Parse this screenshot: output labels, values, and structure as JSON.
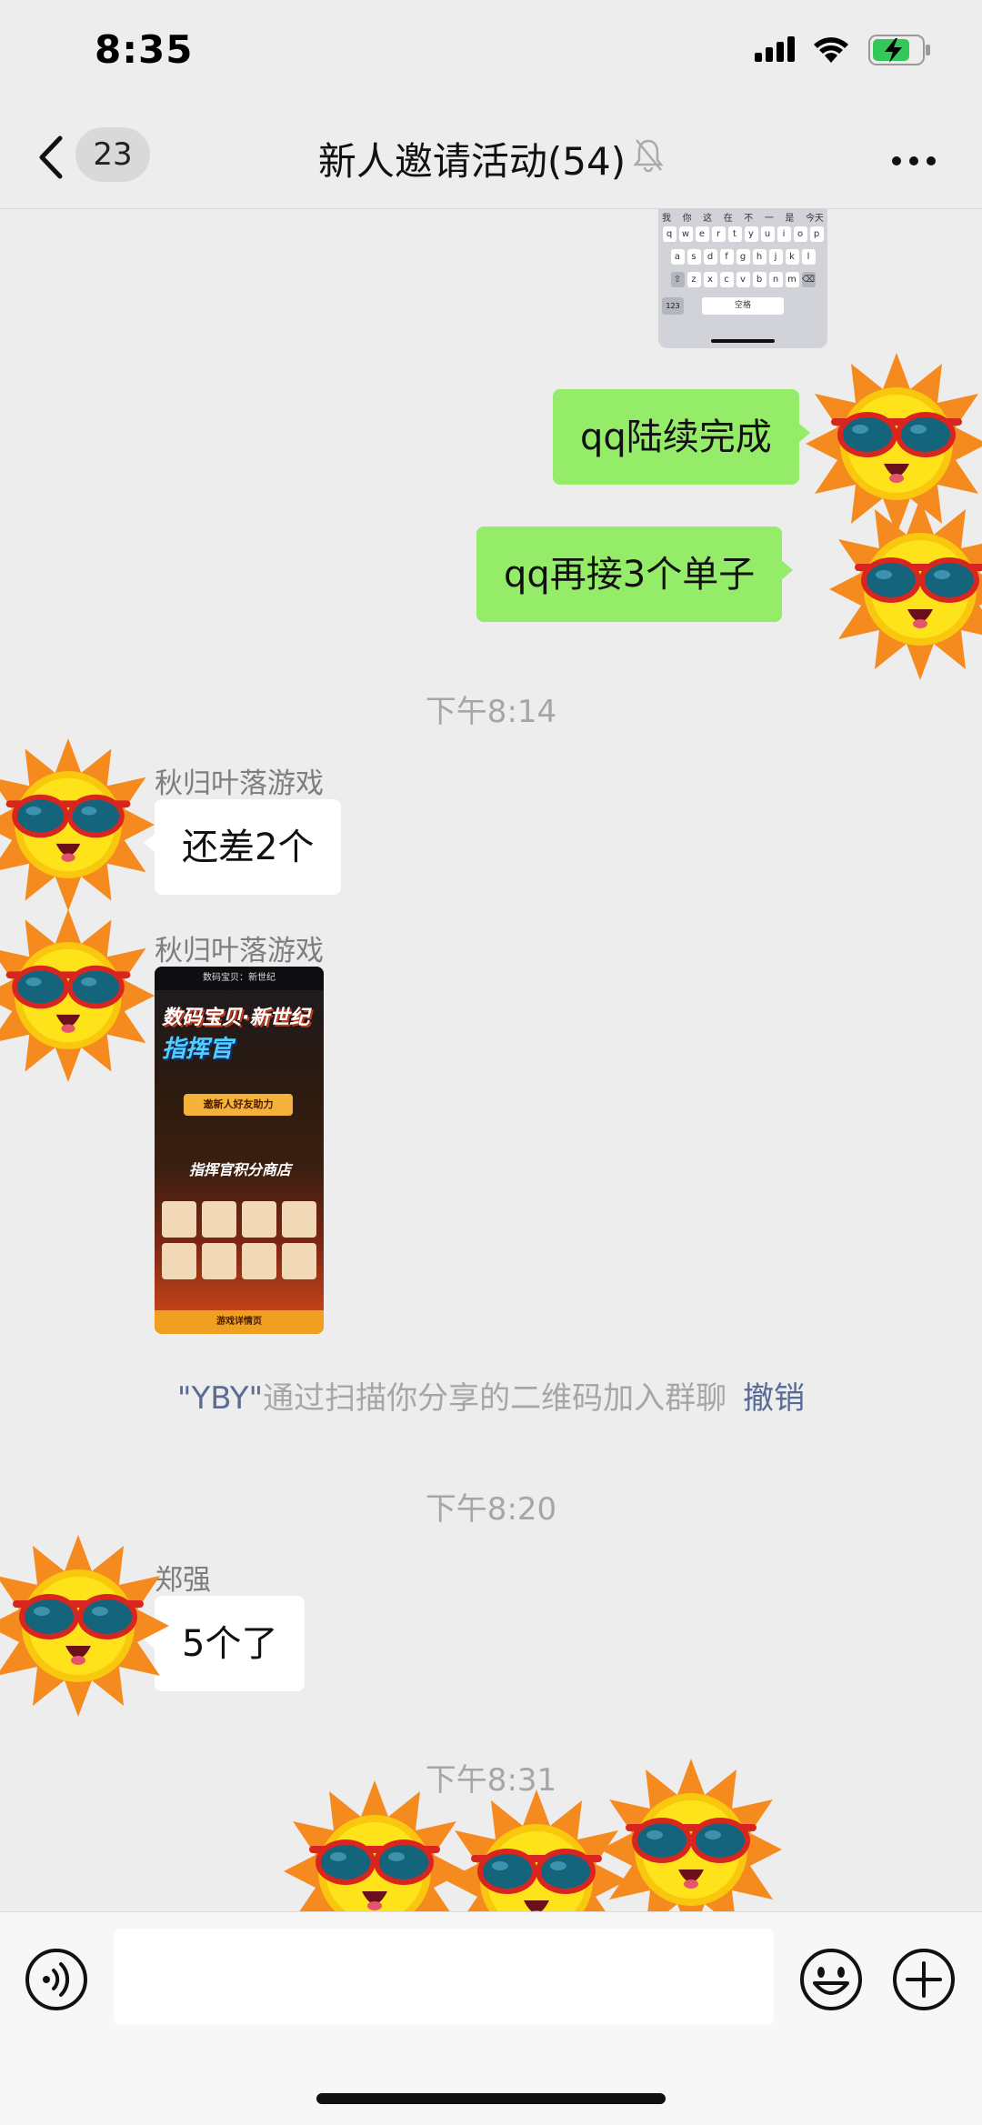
{
  "status_bar": {
    "time": "8:35"
  },
  "nav": {
    "unread_count": "23",
    "title": "新人邀请活动(54)"
  },
  "keyboard_thumb": {
    "suggestions": [
      "我",
      "你",
      "这",
      "在",
      "不",
      "一",
      "是",
      "今天"
    ],
    "row1": [
      "q",
      "w",
      "e",
      "r",
      "t",
      "y",
      "u",
      "i",
      "o",
      "p"
    ],
    "row2": [
      "a",
      "s",
      "d",
      "f",
      "g",
      "h",
      "j",
      "k",
      "l"
    ],
    "row3": [
      "z",
      "x",
      "c",
      "v",
      "b",
      "n",
      "m"
    ],
    "space_label": "空格",
    "num_key": "123"
  },
  "messages": [
    {
      "direction": "out",
      "text": "qq陆续完成"
    },
    {
      "direction": "out",
      "text": "qq再接3个单子"
    },
    {
      "type": "timestamp",
      "text": "下午8:14"
    },
    {
      "direction": "in",
      "sender": "秋归叶落游戏",
      "text": "还差2个"
    },
    {
      "direction": "in",
      "sender": "秋归叶落游戏",
      "type": "image",
      "image": {
        "header": "数码宝贝：新世纪",
        "banner_line1": "数码宝贝·新世纪",
        "banner_line2": "指挥官",
        "button": "邀新人好友助力",
        "shop": "指挥官积分商店",
        "footer": "游戏详情页"
      }
    },
    {
      "type": "system",
      "name": "\"YBY\"",
      "text": "通过扫描你分享的二维码加入群聊",
      "action": "撤销"
    },
    {
      "type": "timestamp",
      "text": "下午8:20"
    },
    {
      "direction": "in",
      "sender": "郑强",
      "text": "5个了"
    },
    {
      "type": "timestamp",
      "text": "下午8:31"
    }
  ],
  "input": {
    "placeholder": ""
  },
  "icons": {
    "voice": "voice-icon",
    "emoji": "emoji-icon",
    "add": "plus-icon",
    "sticker": "sunglasses-sun-sticker"
  },
  "colors": {
    "outgoing_bubble": "#95ec69",
    "incoming_bubble": "#ffffff",
    "background": "#ededed",
    "link": "#576b95"
  }
}
